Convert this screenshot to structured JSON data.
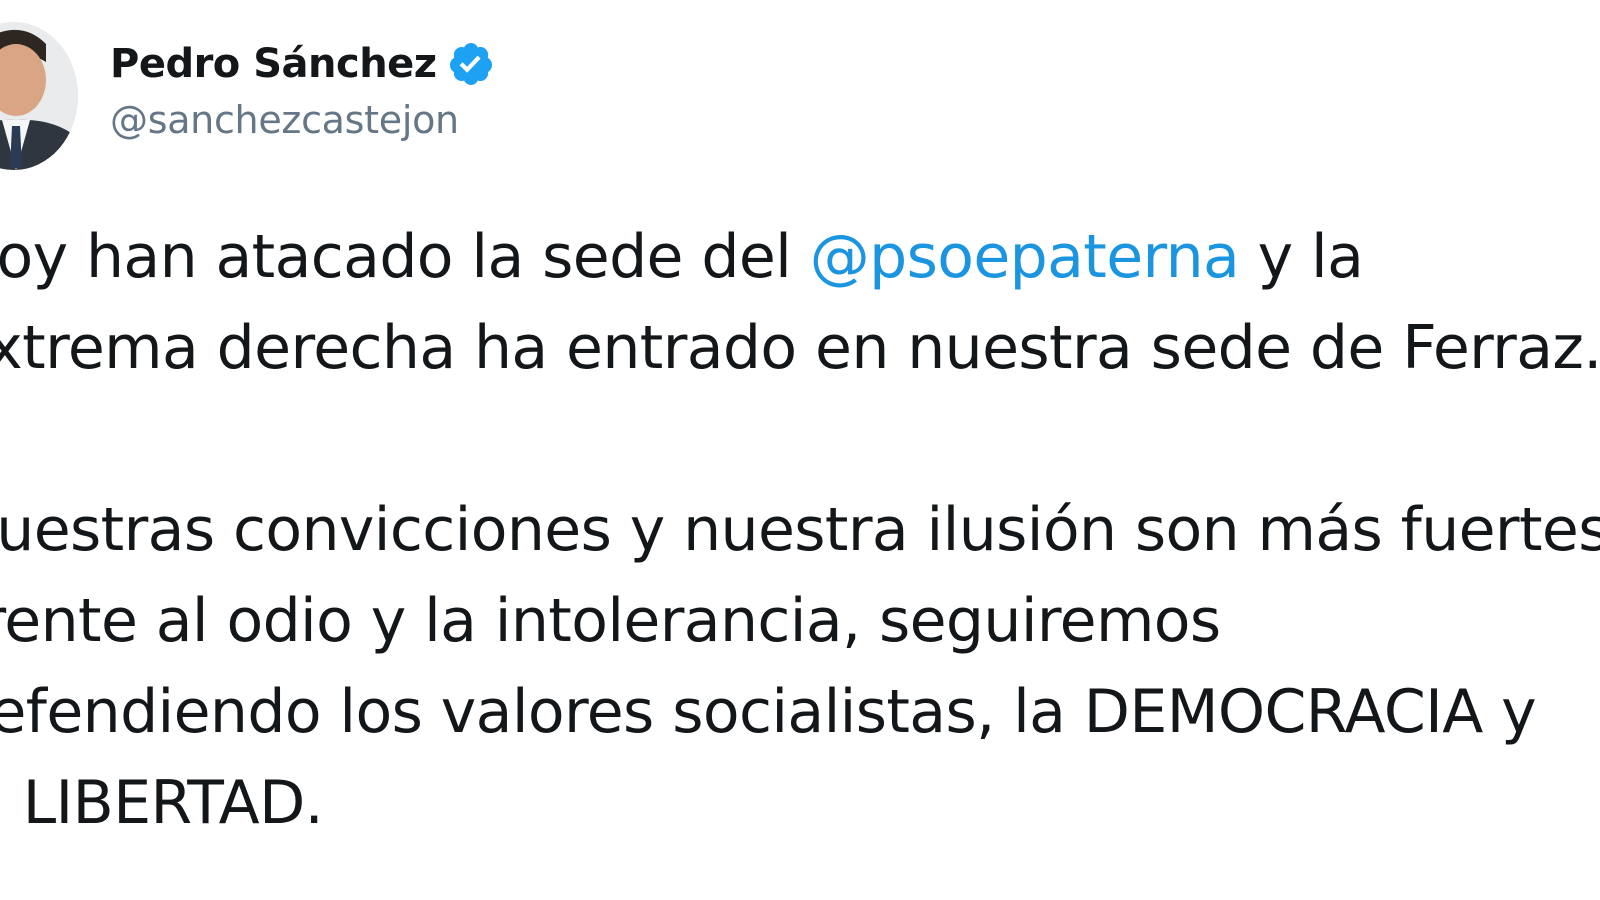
{
  "tweet": {
    "author": {
      "display_name": "Pedro Sánchez",
      "handle": "@sanchezcastejon",
      "verified": true,
      "verified_icon": "verified-badge-icon",
      "verified_color": "#1da1f2"
    },
    "paragraph1": {
      "line1_before": "Hoy han atacado la sede del ",
      "line1_mention": "@psoepaterna",
      "line1_after": " y la",
      "line2": "extrema derecha ha entrado en nuestra sede de Ferraz."
    },
    "paragraph2": {
      "line1": "Nuestras convicciones y nuestra ilusión son más fuertes.",
      "line2": "Frente al odio y la intolerancia, seguiremos",
      "line3": "defendiendo los valores socialistas, la DEMOCRACIA y",
      "line4": "la LIBERTAD."
    },
    "colors": {
      "text": "#14171a",
      "secondary_text": "#657786",
      "mention": "#1b95e0",
      "background": "#ffffff"
    }
  }
}
